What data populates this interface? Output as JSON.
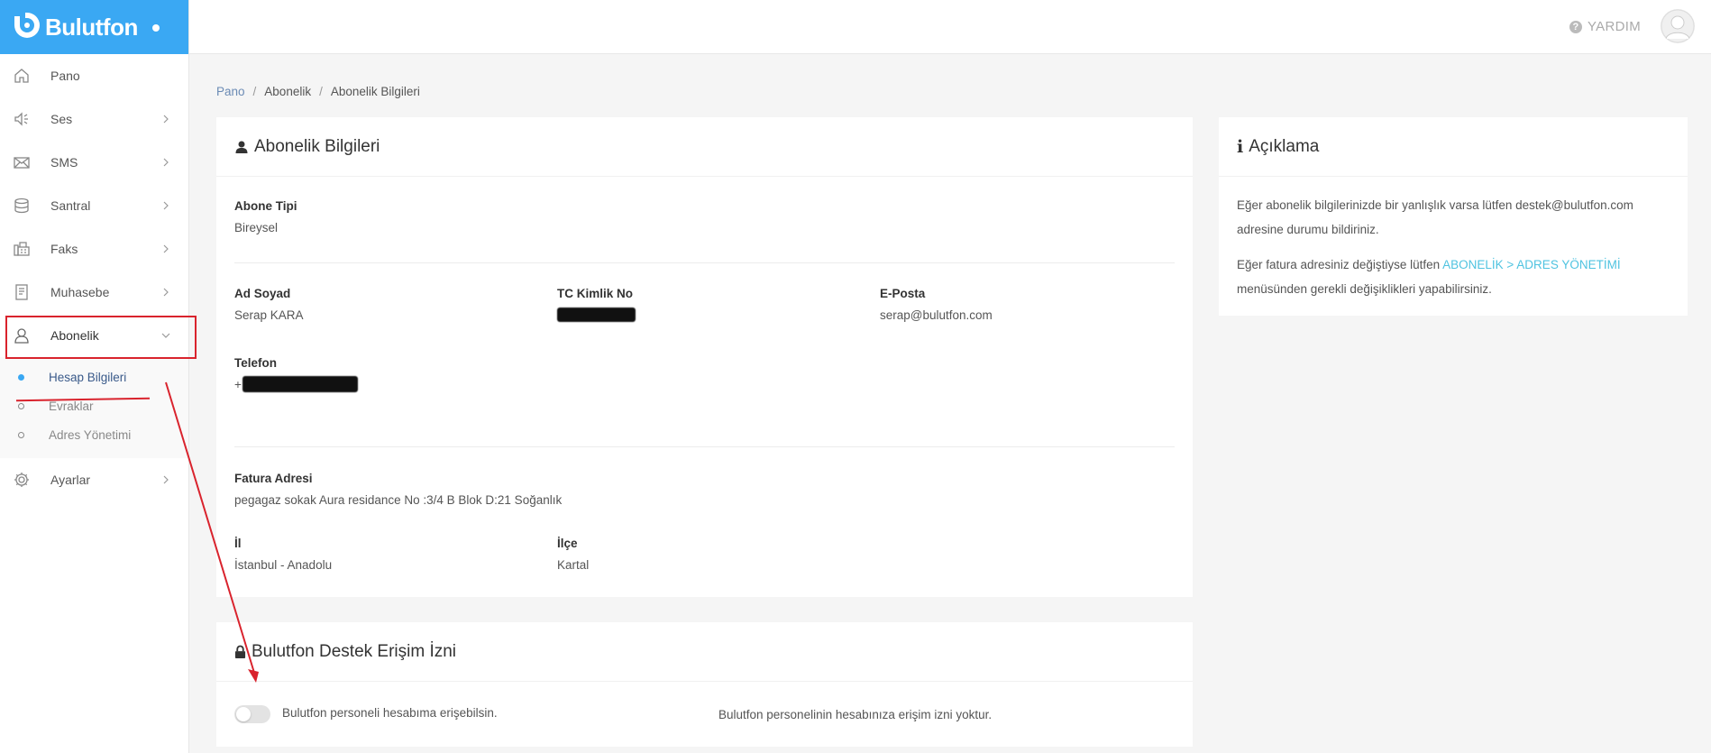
{
  "brand": {
    "name": "Bulutfon"
  },
  "header": {
    "help_label": "YARDIM"
  },
  "sidebar": {
    "items": [
      {
        "label": "Pano"
      },
      {
        "label": "Ses"
      },
      {
        "label": "SMS"
      },
      {
        "label": "Santral"
      },
      {
        "label": "Faks"
      },
      {
        "label": "Muhasebe"
      },
      {
        "label": "Abonelik"
      },
      {
        "label": "Ayarlar"
      }
    ],
    "subitems": [
      {
        "label": "Hesap Bilgileri"
      },
      {
        "label": "Evraklar"
      },
      {
        "label": "Adres Yönetimi"
      }
    ]
  },
  "breadcrumb": {
    "home": "Pano",
    "section": "Abonelik",
    "current": "Abonelik Bilgileri"
  },
  "subscription_card": {
    "title": "Abonelik Bilgileri",
    "subscriber_type": {
      "label": "Abone Tipi",
      "value": "Bireysel"
    },
    "full_name": {
      "label": "Ad Soyad",
      "value": "Serap KARA"
    },
    "tc_id": {
      "label": "TC Kimlik No"
    },
    "email": {
      "label": "E-Posta",
      "value": "serap@bulutfon.com"
    },
    "phone": {
      "label": "Telefon",
      "prefix": "+"
    },
    "billing_address": {
      "label": "Fatura Adresi",
      "value": "pegagaz sokak Aura residance No :3/4 B Blok D:21 Soğanlık"
    },
    "city": {
      "label": "İl",
      "value": "İstanbul - Anadolu"
    },
    "district": {
      "label": "İlçe",
      "value": "Kartal"
    }
  },
  "support_card": {
    "title": "Bulutfon Destek Erişim İzni",
    "toggle_label": "Bulutfon personeli hesabıma erişebilsin.",
    "status_text": "Bulutfon personelinin hesabınıza erişim izni yoktur.",
    "toggle_on": false
  },
  "info_card": {
    "title": "Açıklama",
    "p1_line1": "Eğer abonelik bilgilerinizde bir yanlışlık varsa lütfen destek@bulutfon.com",
    "p1_line2": "adresine durumu bildiriniz.",
    "p2_before": "Eğer fatura adresiniz değiştiyse lütfen ",
    "p2_link": "ABONELİK > ADRES YÖNETİMİ",
    "p2_line2": "menüsünden gerekli değişiklikleri yapabilirsiniz."
  },
  "colors": {
    "brand": "#3aa8f3",
    "annotation": "#d9232d",
    "link": "#4fc3e0"
  }
}
